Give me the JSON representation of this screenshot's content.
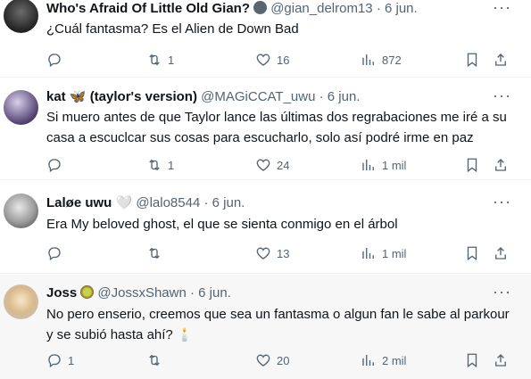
{
  "tweets": [
    {
      "name": "Who's Afraid Of Little Old Gian?",
      "badge": "🌑",
      "handle": "@gian_delrom13",
      "date": "6 jun.",
      "text": "¿Cuál fantasma? Es el Alien de Down Bad",
      "replies": "",
      "retweets": "1",
      "likes": "16",
      "views": "872"
    },
    {
      "name": "kat 🦋 (taylor's version)",
      "badge": "",
      "handle": "@MAGiCCAT_uwu",
      "date": "6 jun.",
      "text": "Si muero antes de que Taylor lance las últimas dos regrabaciones me iré a su casa a escuclcar sus cosas para escucharlo, solo así podré irme en paz",
      "replies": "",
      "retweets": "1",
      "likes": "24",
      "views": "1 mil"
    },
    {
      "name": "Laløe uwu 🤍",
      "badge": "",
      "handle": "@lalo8544",
      "date": "6 jun.",
      "text": "Era My beloved ghost, el que se sienta conmigo en el árbol",
      "replies": "",
      "retweets": "",
      "likes": "13",
      "views": "1 mil"
    },
    {
      "name": "Joss",
      "badge": "🥝",
      "handle": "@JossxShawn",
      "date": "6 jun.",
      "text": "No pero enserio, creemos que sea un fantasma o algun fan le sabe al parkour y se subió hasta ahí? 🕯️",
      "replies": "1",
      "retweets": "",
      "likes": "20",
      "views": "2 mil"
    }
  ],
  "dot": "·",
  "more": "···",
  "icons": [
    "reply-icon",
    "retweet-icon",
    "like-icon",
    "views-icon",
    "bookmark-icon",
    "share-icon"
  ]
}
